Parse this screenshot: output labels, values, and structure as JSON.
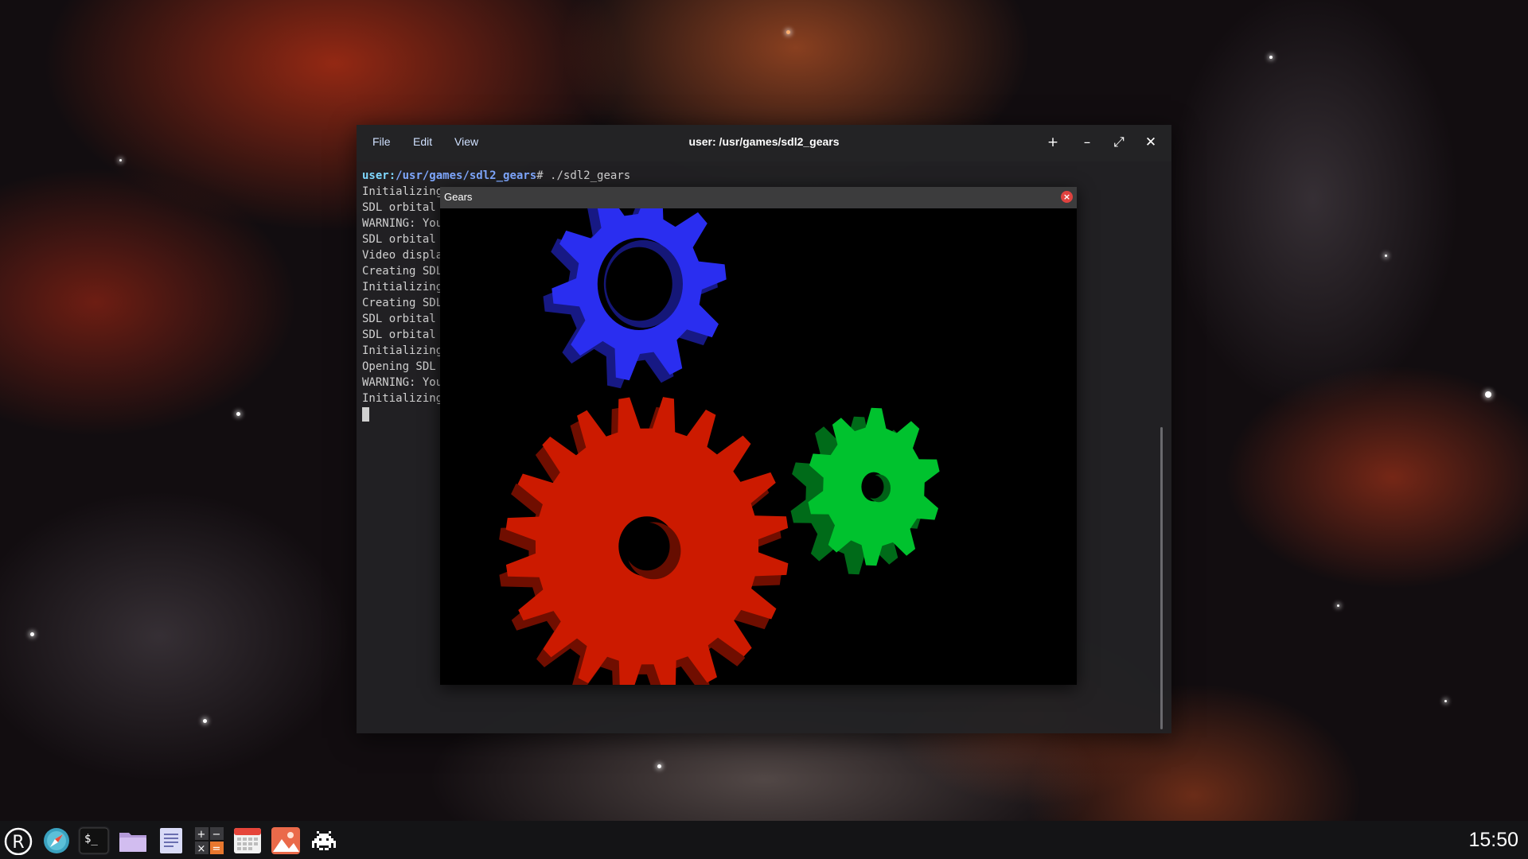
{
  "terminal": {
    "menu": [
      "File",
      "Edit",
      "View"
    ],
    "title": "user: /usr/games/sdl2_gears",
    "buttons": {
      "new_tab": "+",
      "minimize": "–",
      "maximize": "⤢",
      "close": "✕"
    },
    "prompt": {
      "user": "user:",
      "path": "/usr/games/sdl2_gears",
      "symbol": "#",
      "command": " ./sdl2_gears"
    },
    "lines": [
      "Initializing",
      "SDL orbital",
      "WARNING: You",
      "SDL orbital",
      "Video displa",
      "Creating SDL",
      "Initializing",
      "Creating SDL",
      "SDL orbital",
      "SDL orbital",
      "Initializing",
      "Opening SDL",
      "WARNING: You",
      "Initializing"
    ]
  },
  "gears_window": {
    "title": "Gears",
    "close_icon": "close-circle-icon",
    "gears": [
      {
        "name": "red-gear",
        "color": "#cc1a00"
      },
      {
        "name": "green-gear",
        "color": "#00c22e"
      },
      {
        "name": "blue-gear",
        "color": "#2a2ef0"
      }
    ]
  },
  "taskbar": {
    "icons": [
      "launcher-icon",
      "browser-compass-icon",
      "terminal-icon",
      "file-manager-folder-icon",
      "text-editor-icon",
      "calculator-icon",
      "calendar-icon",
      "image-viewer-icon",
      "game-invader-icon"
    ],
    "terminal_icon_text": "$_",
    "launcher_letter": "R",
    "clock": "15:50"
  }
}
